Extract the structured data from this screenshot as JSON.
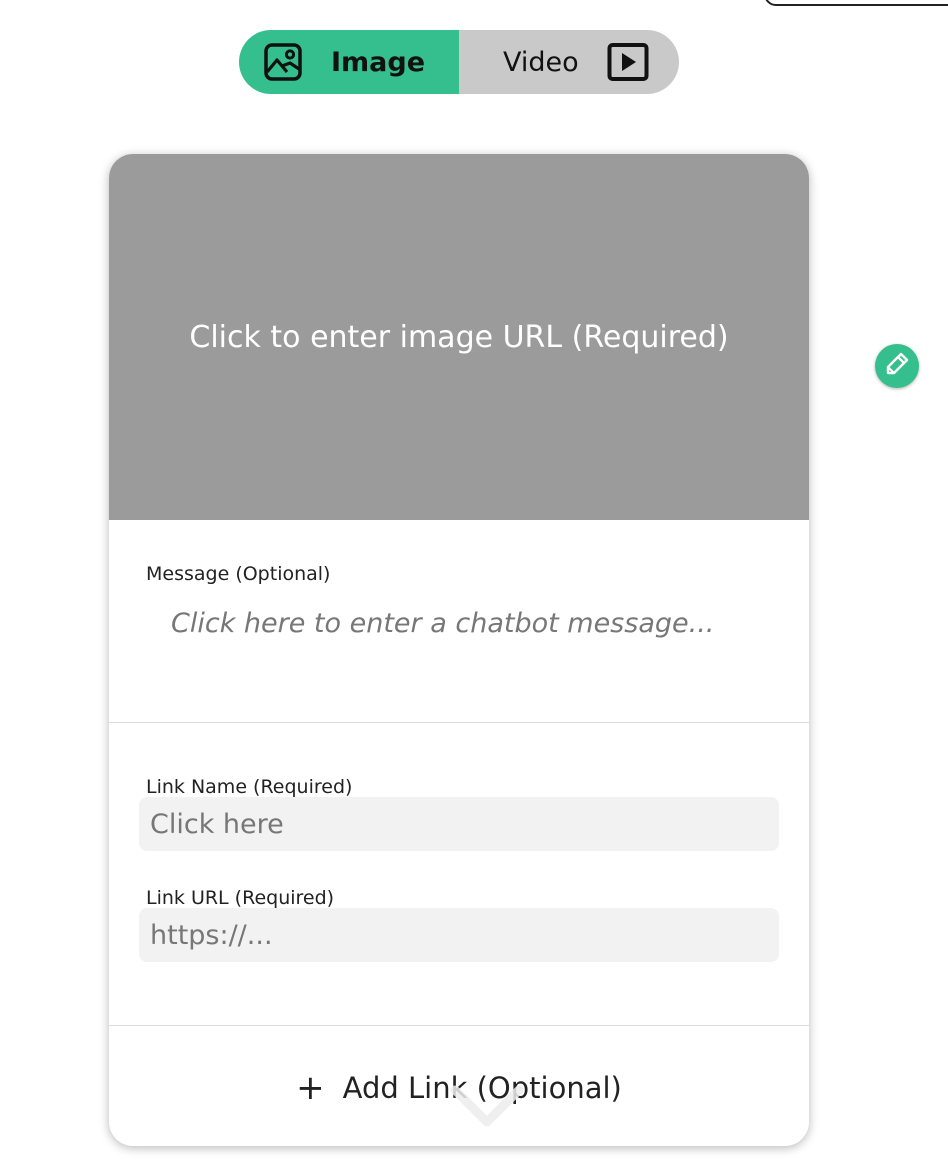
{
  "media_toggle": {
    "image_label": "Image",
    "video_label": "Video",
    "selected": "Image",
    "image_icon": "image-icon",
    "video_icon": "play-box-icon",
    "active_color": "#36bf8e",
    "inactive_color": "#c9c9c9"
  },
  "card": {
    "image_prompt": "Click to enter image URL (Required)",
    "message": {
      "label": "Message (Optional)",
      "placeholder": "Click here to enter a chatbot message..."
    },
    "link_name": {
      "label": "Link Name (Required)",
      "placeholder": "Click here"
    },
    "link_url": {
      "label": "Link URL (Required)",
      "placeholder": "https://..."
    },
    "add_link_label": "Add Link (Optional)",
    "add_link_icon": "plus-icon",
    "collapse_icon": "chevron-down-icon"
  },
  "edit_button": {
    "icon": "pencil-icon",
    "color": "#36bf8e"
  }
}
